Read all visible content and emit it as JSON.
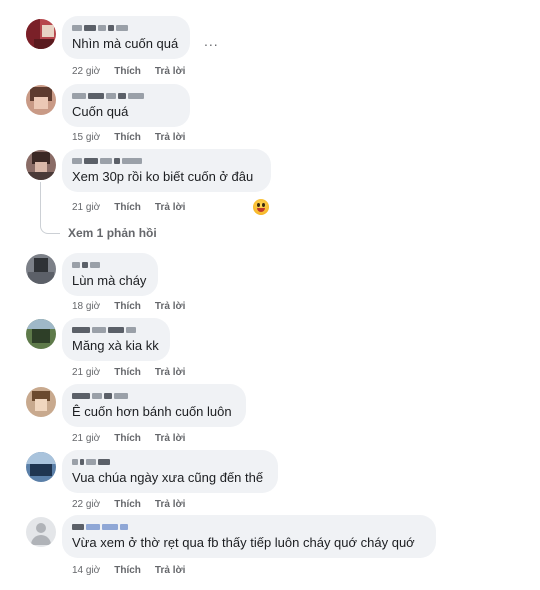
{
  "comments": [
    {
      "text": "Nhìn mà cuốn quá",
      "time": "22 giờ",
      "like": "Thích",
      "reply": "Trả lời"
    },
    {
      "text": "Cuốn quá",
      "time": "15 giờ",
      "like": "Thích",
      "reply": "Trả lời"
    },
    {
      "text": "Xem 30p rồi ko biết cuốn ở đâu",
      "time": "21 giờ",
      "like": "Thích",
      "reply": "Trả lời"
    },
    {
      "text": "Lùn mà cháy",
      "time": "18 giờ",
      "like": "Thích",
      "reply": "Trả lời"
    },
    {
      "text": "Măng xà kia kk",
      "time": "21 giờ",
      "like": "Thích",
      "reply": "Trả lời"
    },
    {
      "text": "Ê cuốn hơn bánh cuốn luôn",
      "time": "21 giờ",
      "like": "Thích",
      "reply": "Trả lời"
    },
    {
      "text": "Vua chúa ngày xưa cũng đến thế",
      "time": "22 giờ",
      "like": "Thích",
      "reply": "Trả lời"
    },
    {
      "text": "Vừa xem ở thờ rẹt qua fb thấy tiếp luôn cháy quớ cháy quớ",
      "time": "14 giờ",
      "like": "Thích",
      "reply": "Trả lời"
    }
  ],
  "more_options": "...",
  "view_replies": "Xem 1 phản hồi",
  "reaction_icon": "laughing-emoji-icon"
}
